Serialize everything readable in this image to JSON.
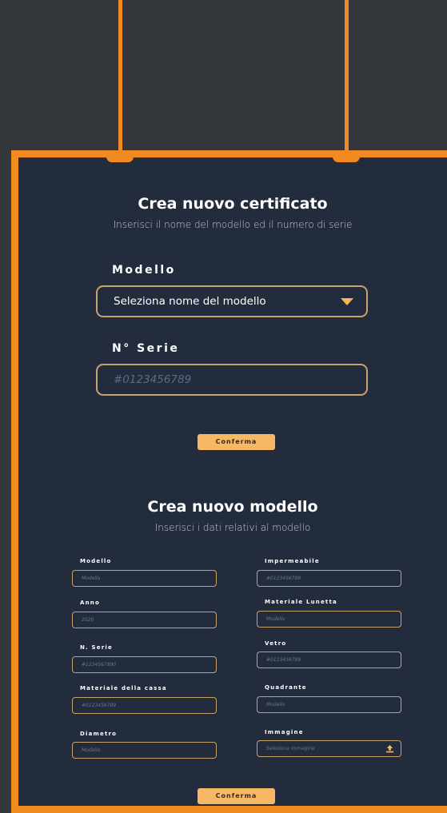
{
  "certificate": {
    "title": "Crea nuovo certificato",
    "subtitle": "Inserisci il nome del modello ed il numero di serie",
    "model_label": "Modello",
    "model_select": "Seleziona nome del modello",
    "serial_label": "N° Serie",
    "serial_placeholder": "#0123456789",
    "confirm": "Conferma"
  },
  "model": {
    "title": "Crea nuovo modello",
    "subtitle": "Inserisci i dati relativi al modello",
    "left_fields": [
      {
        "label": "Modello",
        "placeholder": "Modello"
      },
      {
        "label": "Anno",
        "placeholder": "2020"
      },
      {
        "label": "N. Serie",
        "placeholder": "#1234567890"
      },
      {
        "label": "Materiale della cassa",
        "placeholder": "#0123456789"
      },
      {
        "label": "Diametro",
        "placeholder": "Modello"
      }
    ],
    "right_fields": [
      {
        "label": "Impermeabile",
        "placeholder": "#0123456789"
      },
      {
        "label": "Materiale Lunetta",
        "placeholder": "Modello"
      },
      {
        "label": "Vetro",
        "placeholder": "#0123456789"
      },
      {
        "label": "Quadrante",
        "placeholder": "Modello"
      },
      {
        "label": "Immagine",
        "placeholder": "Seleziona immagine"
      }
    ],
    "confirm": "Conferma"
  },
  "colors": {
    "accent": "#f28a22",
    "panel": "#232c3d",
    "background": "#33363a",
    "button": "#f7b865",
    "field_border": "#c9a46a"
  },
  "icons": {
    "dropdown": "chevron-down-icon",
    "upload": "upload-icon"
  }
}
